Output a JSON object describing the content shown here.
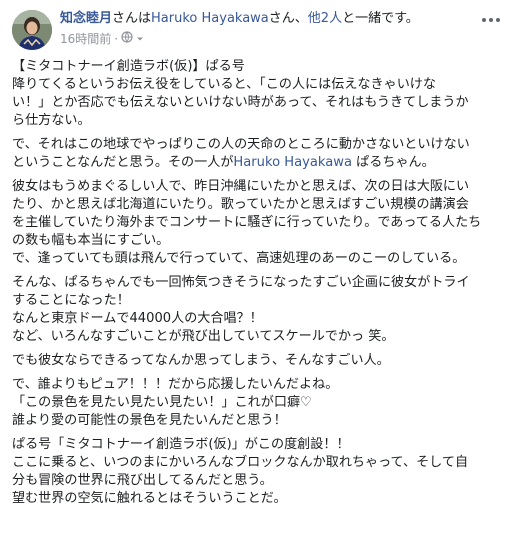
{
  "header": {
    "author": "知念睦月",
    "connector_1": "さんは",
    "tagged_1": "Haruko Hayakawa",
    "connector_2": "さん、",
    "others": "他2人",
    "suffix": "と一緒です。",
    "timestamp": "16時間前",
    "separator": "·",
    "privacy_icon": "globe-icon",
    "menu_icon": "more-icon"
  },
  "body": {
    "p1": [
      "【ミタコトナーイ創造ラボ(仮)】ぱる号",
      "降りてくるというお伝え役をしていると、「この人には伝えなきゃいけな",
      "い！」とか否応でも伝えないといけない時があって、それはもうきてしまうか",
      "ら仕方ない。"
    ],
    "p2": [
      "で、それはこの地球でやっぱりこの人の天命のところに動かさないといけない",
      "ということなんだと思う。その一人が"
    ],
    "p2_link": "Haruko Hayakawa",
    "p2_end": " ぱるちゃん。",
    "p3": [
      "彼女はもうめまぐるしい人で、昨日沖縄にいたかと思えば、次の日は大阪にい",
      "たり、かと思えば北海道にいたり。歌っていたかと思えばすごい規模の講演会",
      "を主催していたり海外までコンサートに騒ぎに行っていたり。であってる人たち",
      "の数も幅も本当にすごい。",
      "で、逢っていても頭は飛んで行っていて、高速処理のあーのこーのしている。"
    ],
    "p4": [
      "そんな、ぱるちゃんでも一回怖気つきそうになったすごい企画に彼女がトライ",
      "することになった！",
      "なんと東京ドームで44000人の大合唱？！",
      "など、いろんなすごいことが飛び出していてスケールでかっ 笑。"
    ],
    "p5": [
      "でも彼女ならできるってなんか思ってしまう、そんなすごい人。"
    ],
    "p6": [
      "で、誰よりもピュア！！！だから応援したいんだよね。",
      "「この景色を見たい見たい見たい！」これが口癖♡",
      "誰より愛の可能性の景色を見たいんだと思う！"
    ],
    "p7": [
      "ぱる号「ミタコトナーイ創造ラボ(仮)」がこの度創設！！",
      "ここに乗ると、いつのまにかいろんなブロックなんか取れちゃって、そして自",
      "分も冒険の世界に飛び出してるんだと思う。",
      "望む世界の空気に触れるとはそういうことだ。"
    ]
  },
  "colors": {
    "link": "#385898",
    "text": "#1c1e21",
    "meta": "#90949c"
  }
}
